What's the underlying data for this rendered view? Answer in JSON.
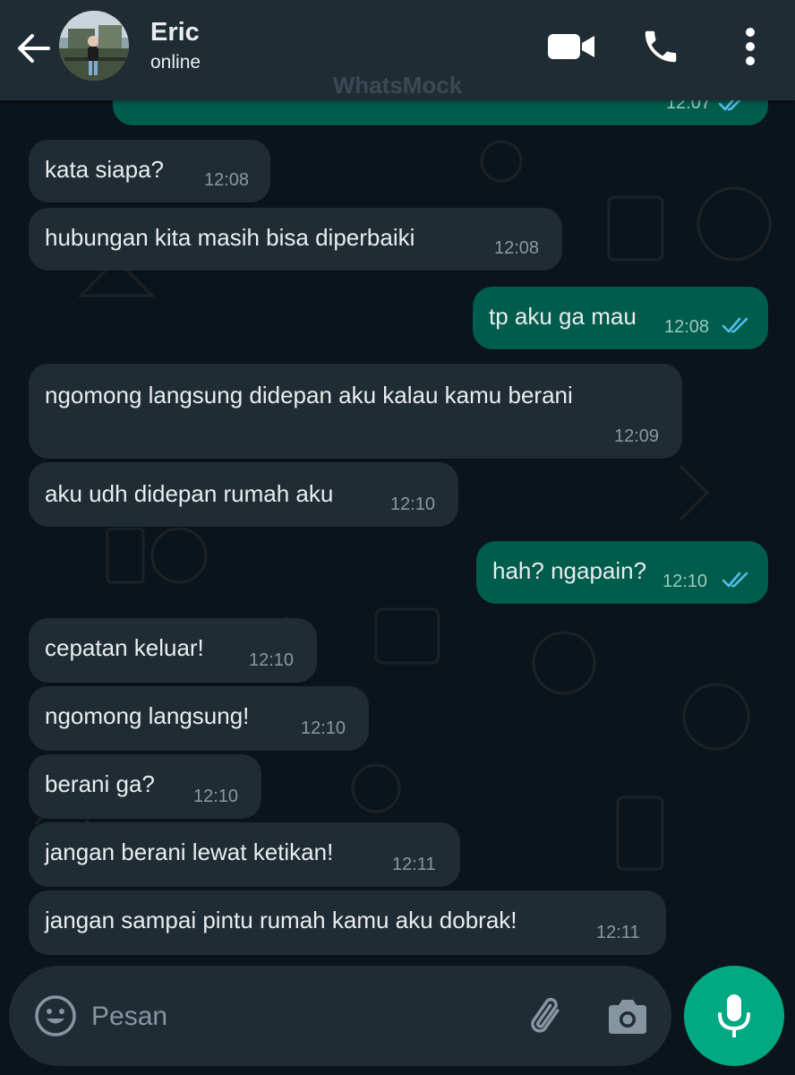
{
  "header": {
    "contact_name": "Eric",
    "status": "online",
    "watermark": "WhatsMock"
  },
  "partial_message": {
    "time": "12:07"
  },
  "messages": [
    {
      "direction": "in",
      "text": "kata siapa?",
      "time": "12:08"
    },
    {
      "direction": "in",
      "text": "hubungan kita masih bisa diperbaiki",
      "time": "12:08"
    },
    {
      "direction": "out",
      "text": "tp aku ga mau",
      "time": "12:08",
      "ticks": "read"
    },
    {
      "direction": "in",
      "text": "ngomong langsung didepan aku kalau kamu berani",
      "time": "12:09"
    },
    {
      "direction": "in",
      "text": "aku udh didepan rumah aku",
      "time": "12:10"
    },
    {
      "direction": "out",
      "text": "hah? ngapain?",
      "time": "12:10",
      "ticks": "read"
    },
    {
      "direction": "in",
      "text": "cepatan keluar!",
      "time": "12:10"
    },
    {
      "direction": "in",
      "text": "ngomong langsung!",
      "time": "12:10"
    },
    {
      "direction": "in",
      "text": "berani ga?",
      "time": "12:10"
    },
    {
      "direction": "in",
      "text": "jangan berani lewat ketikan!",
      "time": "12:11"
    },
    {
      "direction": "in",
      "text": "jangan sampai pintu rumah kamu aku dobrak!",
      "time": "12:11"
    }
  ],
  "input": {
    "placeholder": "Pesan"
  },
  "colors": {
    "background": "#0b141a",
    "header": "#1f2c34",
    "incoming_bubble": "#1f2c34",
    "outgoing_bubble": "#005c4b",
    "read_ticks": "#53bdeb",
    "mic_button": "#00a884"
  },
  "icons": {
    "back": "arrow-left-icon",
    "video": "video-camera-icon",
    "call": "phone-icon",
    "menu": "more-vertical-icon",
    "emoji": "smiley-icon",
    "attach": "paperclip-icon",
    "camera": "camera-icon",
    "mic": "microphone-icon"
  }
}
